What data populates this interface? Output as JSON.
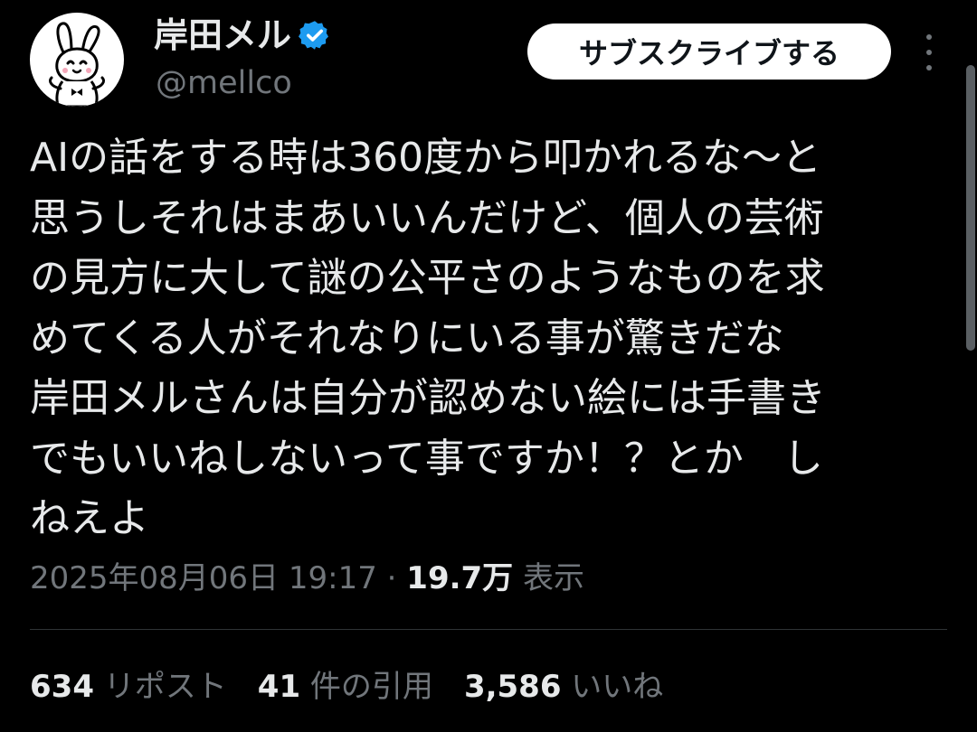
{
  "author": {
    "display_name": "岸田メル",
    "handle": "@mellco",
    "verified": true,
    "verified_color": "#1d9bf0",
    "avatar_icon": "rabbit-avatar-icon"
  },
  "header": {
    "subscribe_label": "サブスクライブする",
    "more_icon": "more-vertical-icon"
  },
  "tweet": {
    "text_lines": [
      "AIの話をする時は360度から叩かれるな〜と",
      "思うしそれはまあいいんだけど、個人の芸術",
      "の見方に大して謎の公平さのようなものを求",
      "めてくる人がそれなりにいる事が驚きだな",
      "岸田メルさんは自分が認めない絵には手書き",
      "でもいいねしないって事ですか！？とか　し",
      "ねえよ"
    ],
    "timestamp": "2025年08月06日 19:17",
    "separator": " · ",
    "views_count": "19.7万",
    "views_label": " 表示"
  },
  "stats": {
    "reposts_count": "634",
    "reposts_label": " リポスト",
    "quotes_count": "41",
    "quotes_label": " 件の引用",
    "likes_count": "3,586",
    "likes_label": " いいね"
  },
  "colors": {
    "background": "#000000",
    "primary_text": "#e7e9ea",
    "secondary_text": "#71767b",
    "divider": "#2f3336"
  }
}
